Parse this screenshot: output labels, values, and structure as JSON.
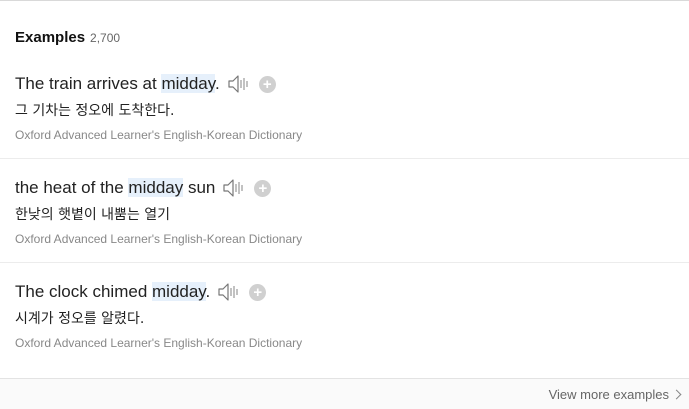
{
  "header": {
    "title": "Examples",
    "count": "2,700"
  },
  "examples": [
    {
      "before": "The train arrives at ",
      "highlight": "midday",
      "after": ".",
      "translation": "그 기차는 정오에 도착한다.",
      "source": "Oxford Advanced Learner's English-Korean Dictionary"
    },
    {
      "before": "the heat of the ",
      "highlight": "midday",
      "after": " sun",
      "translation": "한낮의 햇볕이 내뿜는 열기",
      "source": "Oxford Advanced Learner's English-Korean Dictionary"
    },
    {
      "before": "The clock chimed ",
      "highlight": "midday",
      "after": ".",
      "translation": "시계가 정오를 알렸다.",
      "source": "Oxford Advanced Learner's English-Korean Dictionary"
    }
  ],
  "icons": {
    "speaker": "speaker-icon",
    "add": "plus-icon",
    "add_glyph": "+"
  },
  "footer": {
    "more_label": "View more examples"
  },
  "colors": {
    "highlight_bg": "#e6f0fb",
    "source_text": "#888888"
  }
}
